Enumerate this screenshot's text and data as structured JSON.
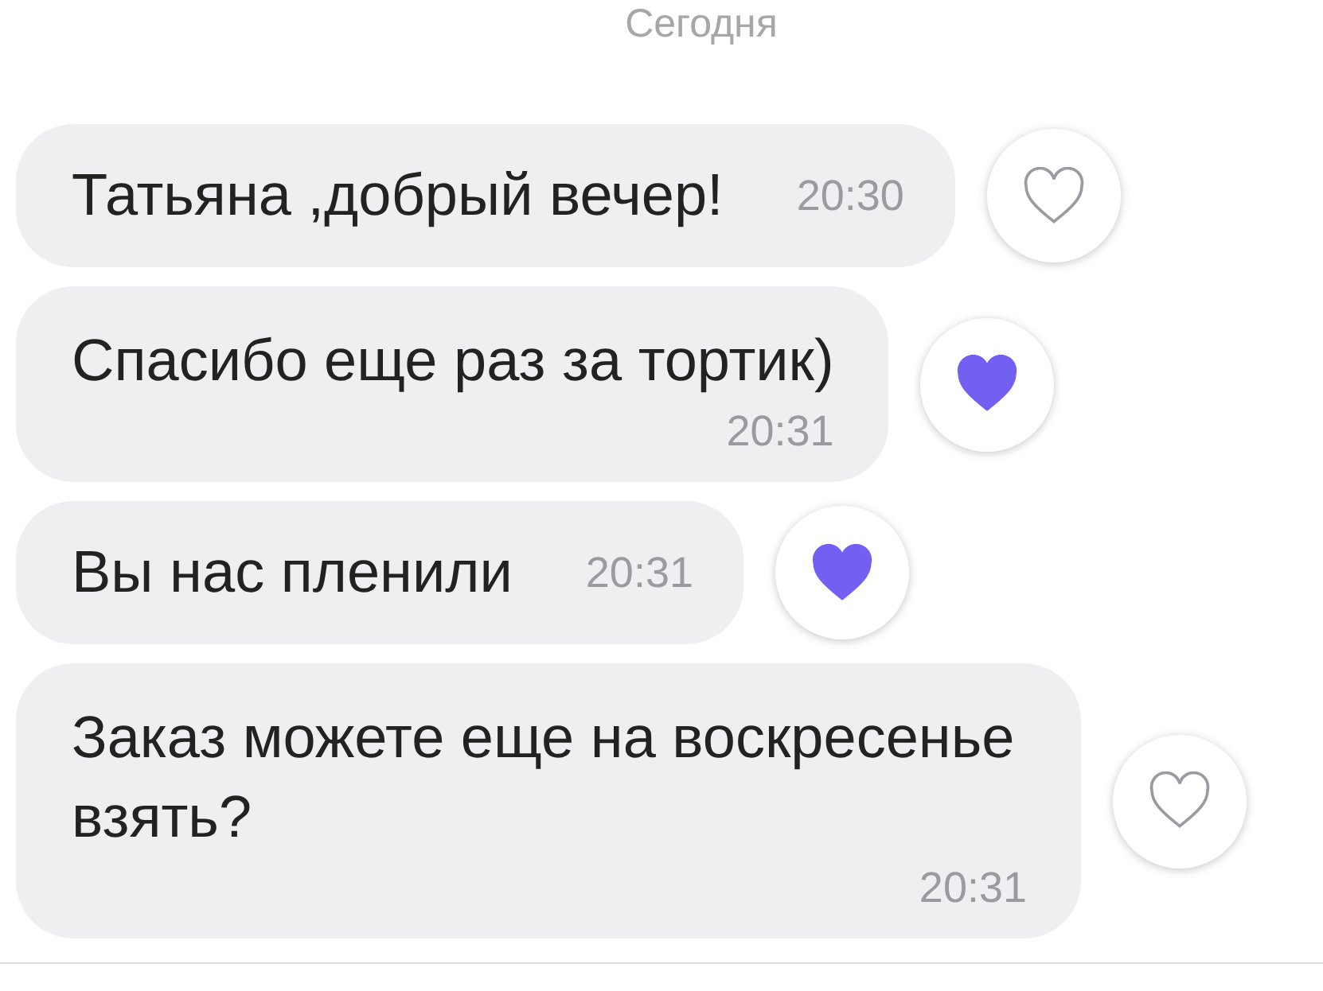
{
  "date_header": "Сегодня",
  "messages": [
    {
      "kind": "inline",
      "text": "Татьяна ,добрый вечер!",
      "time": "20:30",
      "liked": false
    },
    {
      "kind": "stacked",
      "text": "Спасибо еще раз за тортик)",
      "time": "20:31",
      "liked": true
    },
    {
      "kind": "inline",
      "text": "Вы нас пленили",
      "time": "20:31",
      "liked": true
    },
    {
      "kind": "stacked",
      "text": "Заказ можете еще на воскресенье взять?",
      "time": "20:31",
      "liked": false
    }
  ]
}
